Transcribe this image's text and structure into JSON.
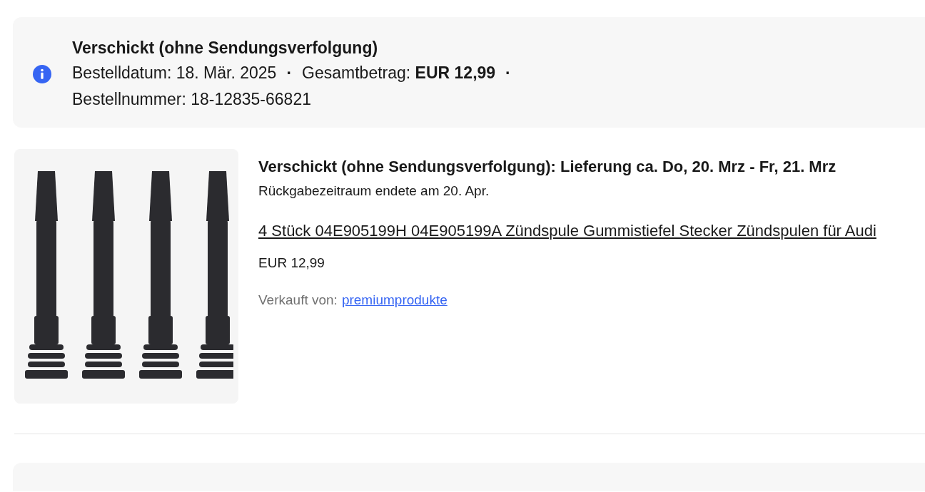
{
  "order_summary": {
    "status": "Verschickt (ohne Sendungsverfolgung)",
    "separator": "·",
    "details": [
      "Bestelldatum: 18. Mär. 2025",
      "Gesamtbetrag: **EUR 12,99**",
      "Bestellnummer: 18-12835-66821"
    ]
  },
  "item": {
    "delivery": "Verschickt (ohne Sendungsverfolgung): Lieferung ca. Do, 20. Mrz - Fr, 21. Mrz",
    "return_note": "Rückgabezeitraum endete am 20. Apr.",
    "title": "4 Stück 04E905199H 04E905199A Zündspule Gummistiefel Stecker Zündspulen für Audi",
    "price": "EUR 12,99",
    "seller_label": "Verkauft von:",
    "seller": "premiumprodukte"
  }
}
